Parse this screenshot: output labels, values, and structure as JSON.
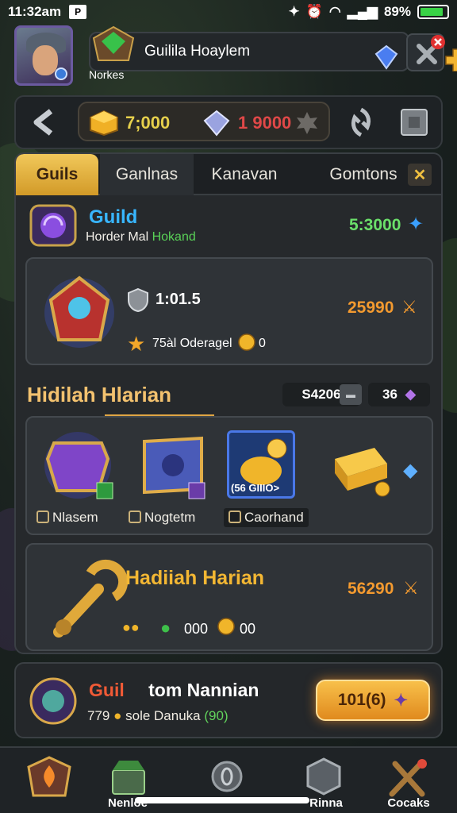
{
  "status": {
    "time": "11:32am",
    "battery": "89%",
    "battery_level": 0.89
  },
  "profile": {
    "guild_name": "Guilila Hoaylem",
    "sub_label": "Norkes"
  },
  "resources": {
    "gold": "7;000",
    "gems": "1 9000"
  },
  "tabs": [
    {
      "label": "Guils"
    },
    {
      "label": "Ganlnas"
    },
    {
      "label": "Kanavan"
    },
    {
      "label": "Gomtons"
    }
  ],
  "guild_card": {
    "title": "Guild",
    "sub_a": "Horder Mal",
    "sub_b": "Hokand",
    "value": "5:3000"
  },
  "boss_card": {
    "level": "1:01.5",
    "reward_text": "75àl Oderagel",
    "reward_coin": "0",
    "value": "25990"
  },
  "daily": {
    "title": "Hidilah Hlarian",
    "pill_value": "S4206",
    "pill_count": "36"
  },
  "rewards": [
    {
      "label": "Nlasem"
    },
    {
      "label": "Nogtetm"
    },
    {
      "label": "Caorhand",
      "badge": "(56 GIIIO>"
    }
  ],
  "hadiah_card": {
    "title": "Hadiiah Harian",
    "coins_a": "000",
    "coins_b": "00",
    "value": "56290"
  },
  "event": {
    "title_a": "Guil",
    "title_b": "tom Nannian",
    "count": "779",
    "sub": "sole Danuka",
    "sub_green": "(90)",
    "button": "101(6)"
  },
  "nav": [
    {
      "label": ""
    },
    {
      "label": "Nenloe"
    },
    {
      "label": ""
    },
    {
      "label": "Rinna"
    },
    {
      "label": "Cocaks"
    }
  ],
  "colors": {
    "gold_tab": "#f1c85a",
    "accent_blue": "#38b6ff",
    "orange": "#f39a2f",
    "green": "#59d157"
  }
}
